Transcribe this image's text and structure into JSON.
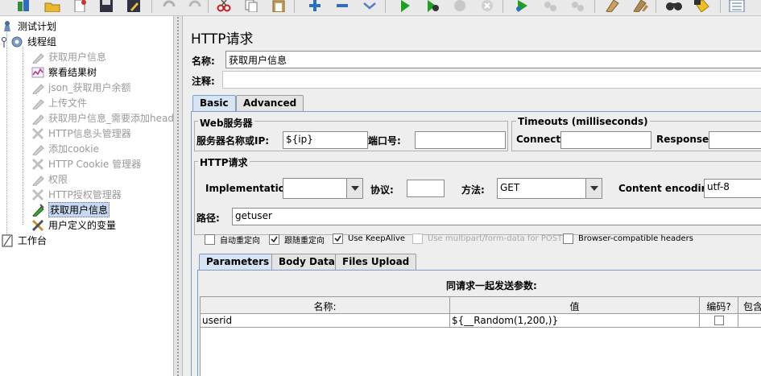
{
  "toolbar": {
    "icons": [
      "templates-icon",
      "open-icon",
      "new-icon",
      "save-icon",
      "save-as-icon",
      "undo-icon",
      "redo-icon",
      "cut-icon",
      "copy-icon",
      "paste-icon",
      "expand-icon",
      "collapse-icon",
      "toggle-icon",
      "start-icon",
      "start-no-pause-icon",
      "stop-icon",
      "shutdown-icon",
      "remote-start-icon",
      "remote-stop-icon",
      "remote-exit-icon",
      "clear-icon",
      "clear-all-icon",
      "search-icon",
      "reset-search-icon",
      "function-helper-icon"
    ]
  },
  "tree": {
    "items": [
      {
        "label": "测试计划"
      },
      {
        "label": "线程组"
      },
      {
        "label": "获取用户信息"
      },
      {
        "label": "察看结果树"
      },
      {
        "label": "json_获取用户余额"
      },
      {
        "label": "上传文件"
      },
      {
        "label": "获取用户信息_需要添加header"
      },
      {
        "label": "HTTP信息头管理器"
      },
      {
        "label": "添加cookie"
      },
      {
        "label": "HTTP Cookie 管理器"
      },
      {
        "label": "权限"
      },
      {
        "label": "HTTP授权管理器"
      },
      {
        "label": "获取用户信息"
      },
      {
        "label": "用户定义的变量"
      },
      {
        "label": "工作台"
      }
    ]
  },
  "panel": {
    "title": "HTTP请求",
    "name_label": "名称:",
    "name_value": "获取用户信息",
    "comment_label": "注释:",
    "comment_value": "",
    "tabs": [
      "Basic",
      "Advanced"
    ],
    "web_server": {
      "title": "Web服务器",
      "server_label": "服务器名称或IP:",
      "server_value": "${ip}",
      "port_label": "端口号:",
      "port_value": ""
    },
    "timeouts": {
      "title": "Timeouts (milliseconds)",
      "connect_label": "Connect:",
      "connect_value": "",
      "response_label": "Response:",
      "response_value": ""
    },
    "http_request": {
      "title": "HTTP请求",
      "impl_label": "Implementation:",
      "impl_value": "",
      "protocol_label": "协议:",
      "protocol_value": "",
      "method_label": "方法:",
      "method_value": "GET",
      "encoding_label": "Content encoding:",
      "encoding_value": "utf-8",
      "path_label": "路径:",
      "path_value": "getuser"
    },
    "options": [
      {
        "label": "自动重定向",
        "checked": false,
        "enabled": true
      },
      {
        "label": "跟随重定向",
        "checked": true,
        "enabled": true
      },
      {
        "label": "Use KeepAlive",
        "checked": true,
        "enabled": true
      },
      {
        "label": "Use multipart/form-data for POST",
        "checked": false,
        "enabled": false
      },
      {
        "label": "Browser-compatible headers",
        "checked": false,
        "enabled": true
      }
    ],
    "sub_tabs": [
      "Parameters",
      "Body Data",
      "Files Upload"
    ],
    "params": {
      "caption": "同请求一起发送参数:",
      "columns": [
        "名称:",
        "值",
        "编码?",
        "包含"
      ],
      "rows": [
        {
          "name": "userid",
          "value": "${__Random(1,200,)}",
          "encode": false
        }
      ]
    }
  }
}
